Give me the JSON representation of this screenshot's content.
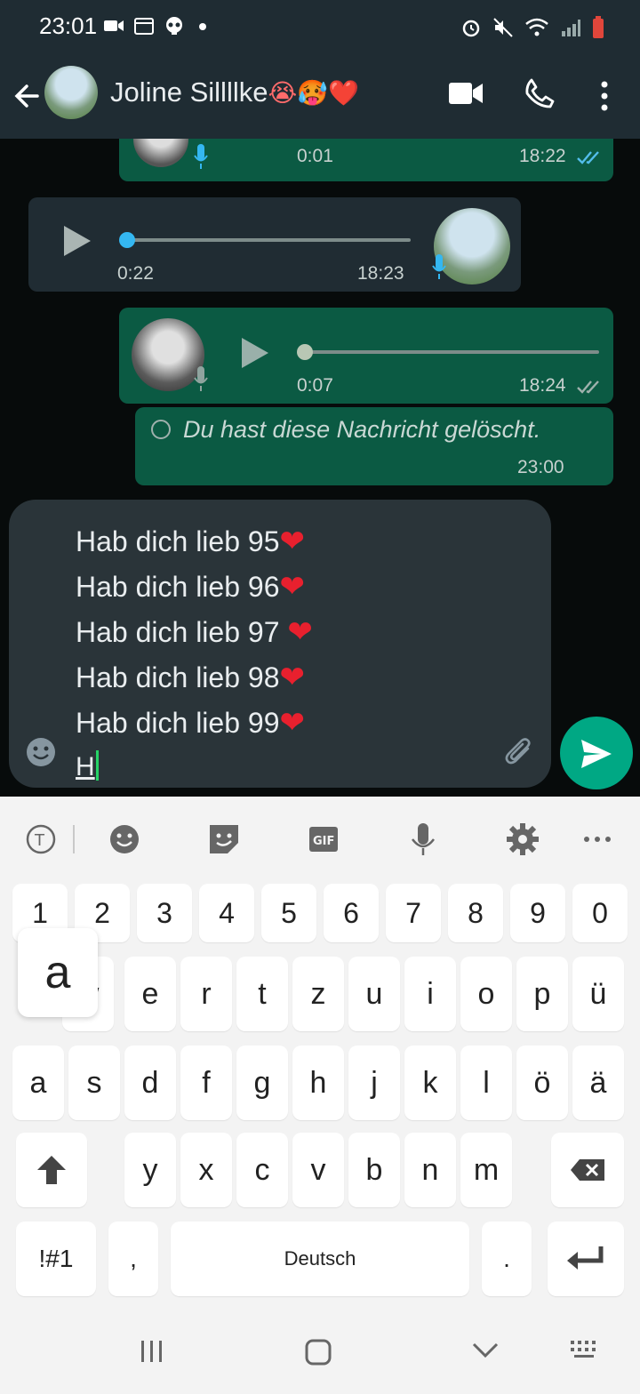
{
  "status_bar": {
    "time": "23:01"
  },
  "header": {
    "contact_name": "Joline Sillllke",
    "name_emojis": "😭🥵❤️",
    "icons": [
      "back-arrow-icon",
      "video-call-icon",
      "voice-call-icon",
      "more-options-icon"
    ]
  },
  "messages": [
    {
      "type": "voice",
      "direction": "out",
      "duration": "0:01",
      "time": "18:22",
      "read": true
    },
    {
      "type": "voice",
      "direction": "in",
      "duration": "0:22",
      "time": "18:23"
    },
    {
      "type": "voice",
      "direction": "out",
      "duration": "0:07",
      "time": "18:24",
      "read": true
    },
    {
      "type": "deleted",
      "direction": "out",
      "text": "Du hast diese Nachricht gelöscht.",
      "time": "23:00"
    }
  ],
  "composer": {
    "lines": [
      "Hab dich lieb 95",
      "Hab dich lieb 96",
      "Hab dich lieb 97",
      "Hab dich lieb 98",
      "Hab dich lieb 99"
    ],
    "heart": "❤",
    "current_text": "H"
  },
  "keyboard": {
    "number_row": [
      "1",
      "2",
      "3",
      "4",
      "5",
      "6",
      "7",
      "8",
      "9",
      "0"
    ],
    "row1": [
      "w",
      "e",
      "r",
      "t",
      "z",
      "u",
      "i",
      "o",
      "p",
      "ü"
    ],
    "row2": [
      "a",
      "s",
      "d",
      "f",
      "g",
      "h",
      "j",
      "k",
      "l",
      "ö",
      "ä"
    ],
    "row3": [
      "y",
      "x",
      "c",
      "v",
      "b",
      "n",
      "m"
    ],
    "symbols_label": "!#1",
    "comma": ",",
    "space_label": "Deutsch",
    "period": ".",
    "popup_letter": "a"
  },
  "colors": {
    "header_bg": "#1f2c33",
    "outgoing_bubble": "#0b5a43",
    "incoming_bubble": "#202c33",
    "accent": "#00a884"
  }
}
